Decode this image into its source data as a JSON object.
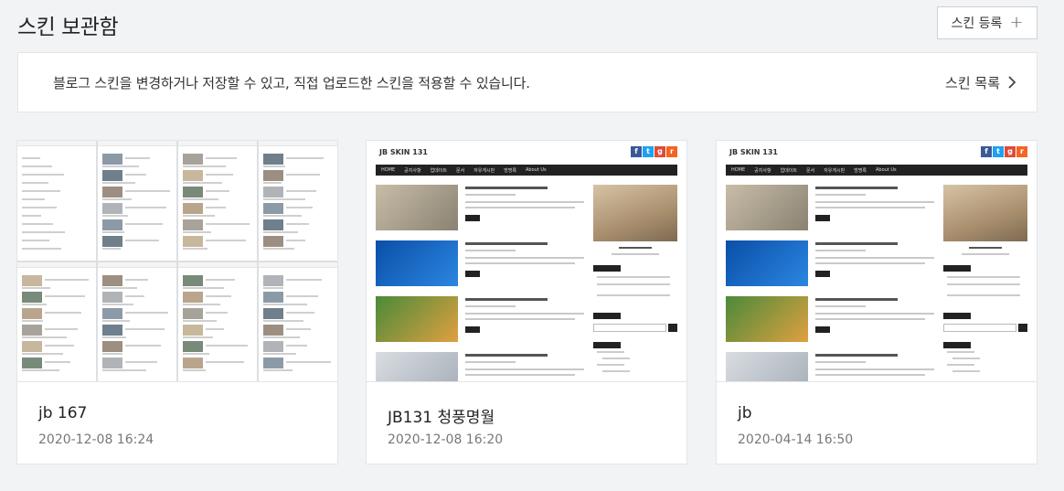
{
  "header": {
    "title": "스킨 보관함",
    "add_button_label": "스킨 등록",
    "add_icon": "plus-icon"
  },
  "notice": {
    "text": "블로그 스킨을 변경하거나 저장할 수 있고, 직접 업로드한 스킨을 적용할 수 있습니다.",
    "link_label": "스킨 목록",
    "link_icon": "chevron-right-icon"
  },
  "skins": [
    {
      "name": "jb 167",
      "date": "2020-12-08 16:24"
    },
    {
      "name": "JB131 청풍명월",
      "date": "2020-12-08 16:20",
      "preview_title": "JB SKIN 131"
    },
    {
      "name": "jb",
      "date": "2020-04-14 16:50",
      "preview_title": "JB SKIN 131"
    }
  ],
  "preview_nav": [
    "HOME",
    "공지사항",
    "업데이트",
    "문서",
    "자유게시판",
    "방명록",
    "About Us"
  ],
  "colors": {
    "background": "#f2f3f5",
    "card": "#ffffff",
    "border": "#e3e5e8",
    "facebook": "#3b5998",
    "twitter": "#1da1f2",
    "google": "#dd4b39",
    "rss": "#f26522"
  }
}
